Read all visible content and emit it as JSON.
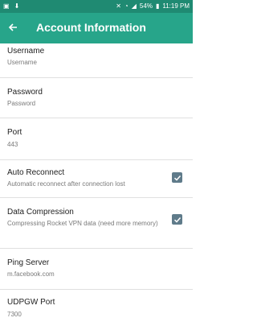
{
  "status_bar": {
    "battery": "54%",
    "time": "11:19 PM"
  },
  "app_bar": {
    "title": "Account Information",
    "back_icon": "arrow-back-icon"
  },
  "settings": [
    {
      "title": "Username",
      "summary": "Username"
    },
    {
      "title": "Password",
      "summary": "Password"
    },
    {
      "title": "Port",
      "summary": "443"
    },
    {
      "title": "Auto Reconnect",
      "summary": "Automatic reconnect after connection lost",
      "checked": true
    },
    {
      "title": "Data Compression",
      "summary": "Compressing Rocket VPN data (need more memory)",
      "checked": true
    },
    {
      "title": "Ping Server",
      "summary": "m.facebook.com"
    },
    {
      "title": "UDPGW Port",
      "summary": "7300"
    }
  ],
  "colors": {
    "status_bar": "#1f8a72",
    "app_bar": "#27a58a",
    "checkbox": "#5f7b8a"
  }
}
